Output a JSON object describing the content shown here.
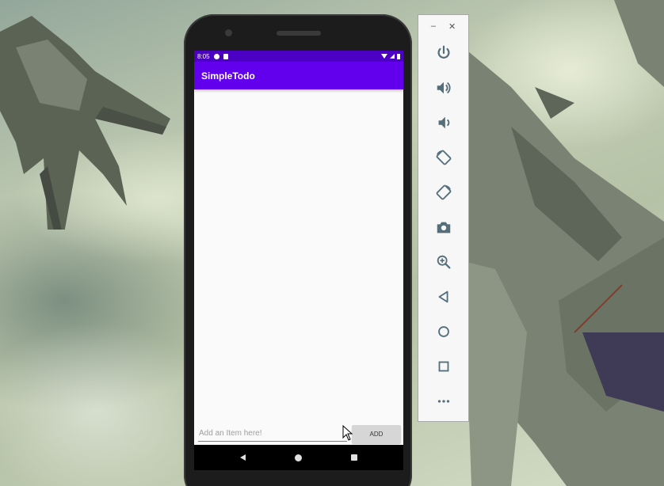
{
  "app": {
    "title": "SimpleTodo"
  },
  "status_bar": {
    "time": "8:05"
  },
  "input": {
    "placeholder": "Add an Item here!",
    "value": ""
  },
  "add_button": {
    "label": "ADD"
  },
  "toolbar": {
    "minimize": "–",
    "close": "✕",
    "items": [
      "power-icon",
      "volume-up-icon",
      "volume-down-icon",
      "rotate-left-icon",
      "rotate-right-icon",
      "camera-icon",
      "zoom-icon",
      "back-icon",
      "home-icon",
      "overview-icon",
      "more-icon"
    ]
  },
  "colors": {
    "app_bar": "#6200ee",
    "status_bar": "#4c00c4",
    "accent": "#26a69a",
    "toolbar_icon": "#546e7a"
  }
}
